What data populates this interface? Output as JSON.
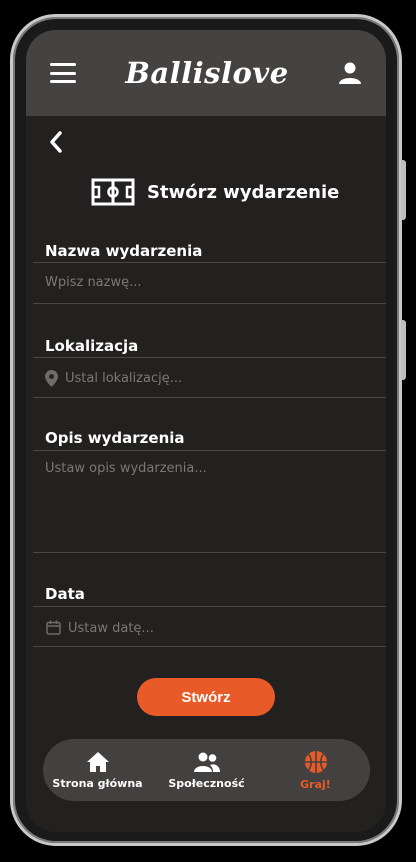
{
  "header": {
    "brand": "Ballislove"
  },
  "page": {
    "title": "Stwórz wydarzenie"
  },
  "form": {
    "name": {
      "label": "Nazwa wydarzenia",
      "placeholder": "Wpisz nazwę..."
    },
    "location": {
      "label": "Lokalizacja",
      "placeholder": "Ustal lokalizację..."
    },
    "description": {
      "label": "Opis wydarzenia",
      "placeholder": "Ustaw opis wydarzenia..."
    },
    "date": {
      "label": "Data",
      "placeholder": "Ustaw datę..."
    },
    "submit_label": "Stwórz"
  },
  "nav": {
    "items": [
      {
        "label": "Strona główna",
        "icon": "home-icon"
      },
      {
        "label": "Społeczność",
        "icon": "people-icon"
      },
      {
        "label": "Graj!",
        "icon": "basketball-icon",
        "active": true
      }
    ]
  },
  "colors": {
    "accent": "#e85a28",
    "background": "#222120",
    "header": "#454341",
    "nav": "#434140"
  }
}
